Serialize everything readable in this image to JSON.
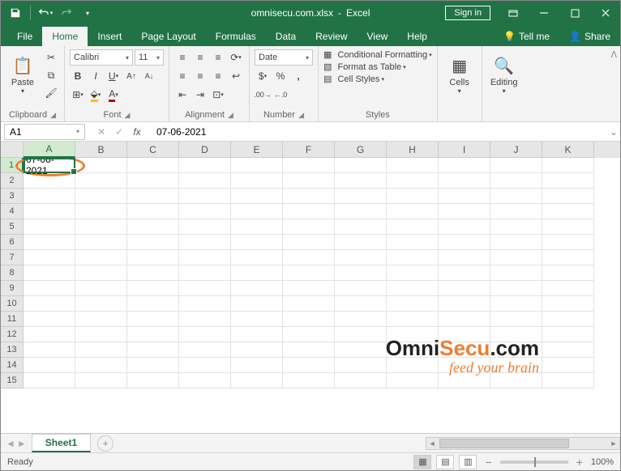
{
  "titlebar": {
    "filename": "omnisecu.com.xlsx",
    "appname": "Excel",
    "signin": "Sign in"
  },
  "tabs": {
    "file": "File",
    "home": "Home",
    "insert": "Insert",
    "pagelayout": "Page Layout",
    "formulas": "Formulas",
    "data": "Data",
    "review": "Review",
    "view": "View",
    "help": "Help",
    "tellme": "Tell me",
    "share": "Share"
  },
  "ribbon": {
    "clipboard": {
      "label": "Clipboard",
      "paste": "Paste"
    },
    "font": {
      "label": "Font",
      "name": "Calibri",
      "size": "11"
    },
    "alignment": {
      "label": "Alignment"
    },
    "number": {
      "label": "Number",
      "format": "Date"
    },
    "styles": {
      "label": "Styles",
      "cond": "Conditional Formatting",
      "table": "Format as Table",
      "cell": "Cell Styles"
    },
    "cells": {
      "label": "Cells"
    },
    "editing": {
      "label": "Editing"
    }
  },
  "formula": {
    "namebox": "A1",
    "value": "07-06-2021"
  },
  "grid": {
    "columns": [
      "A",
      "B",
      "C",
      "D",
      "E",
      "F",
      "G",
      "H",
      "I",
      "J",
      "K"
    ],
    "rows": [
      "1",
      "2",
      "3",
      "4",
      "5",
      "6",
      "7",
      "8",
      "9",
      "10",
      "11",
      "12",
      "13",
      "14",
      "15"
    ],
    "cellA1": "07-06-2021"
  },
  "watermark": {
    "part1": "Omni",
    "part2": "Secu",
    "part3": ".com",
    "tagline": "feed your brain"
  },
  "sheets": {
    "sheet1": "Sheet1"
  },
  "status": {
    "ready": "Ready",
    "zoom": "100%"
  }
}
